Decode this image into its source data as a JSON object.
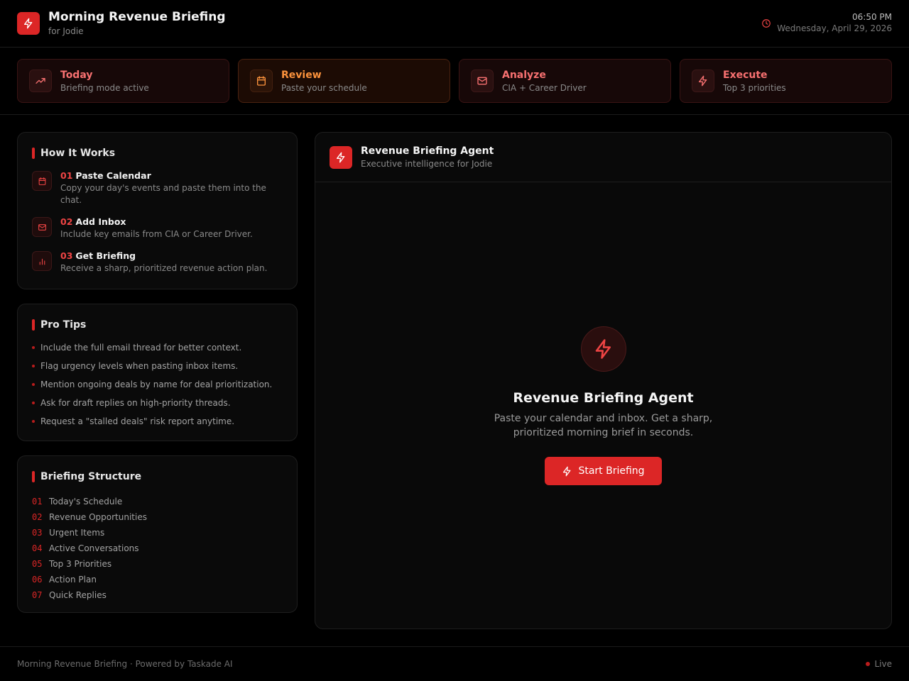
{
  "header": {
    "title": "Morning Revenue Briefing",
    "subtitle": "for Jodie",
    "time": "06:50 PM",
    "date": "Wednesday, April 29, 2026",
    "logo_icon": "lightning-icon",
    "clock_icon": "clock-icon"
  },
  "steps": [
    {
      "title": "Today",
      "subtitle": "Briefing mode active",
      "icon": "trending-up-icon"
    },
    {
      "title": "Review",
      "subtitle": "Paste your schedule",
      "icon": "calendar-icon"
    },
    {
      "title": "Analyze",
      "subtitle": "CIA + Career Driver",
      "icon": "mail-icon"
    },
    {
      "title": "Execute",
      "subtitle": "Top 3 priorities",
      "icon": "lightning-icon"
    }
  ],
  "how_it_works": {
    "title": "How It Works",
    "items": [
      {
        "num": "01",
        "title": "Paste Calendar",
        "desc": "Copy your day's events and paste them into the chat.",
        "icon": "calendar-icon"
      },
      {
        "num": "02",
        "title": "Add Inbox",
        "desc": "Include key emails from CIA or Career Driver.",
        "icon": "mail-icon"
      },
      {
        "num": "03",
        "title": "Get Briefing",
        "desc": "Receive a sharp, prioritized revenue action plan.",
        "icon": "bar-chart-icon"
      }
    ]
  },
  "pro_tips": {
    "title": "Pro Tips",
    "items": [
      "Include the full email thread for better context.",
      "Flag urgency levels when pasting inbox items.",
      "Mention ongoing deals by name for deal prioritization.",
      "Ask for draft replies on high-priority threads.",
      "Request a \"stalled deals\" risk report anytime."
    ]
  },
  "briefing_structure": {
    "title": "Briefing Structure",
    "items": [
      {
        "num": "01",
        "label": "Today's Schedule"
      },
      {
        "num": "02",
        "label": "Revenue Opportunities"
      },
      {
        "num": "03",
        "label": "Urgent Items"
      },
      {
        "num": "04",
        "label": "Active Conversations"
      },
      {
        "num": "05",
        "label": "Top 3 Priorities"
      },
      {
        "num": "06",
        "label": "Action Plan"
      },
      {
        "num": "07",
        "label": "Quick Replies"
      }
    ]
  },
  "agent": {
    "title": "Revenue Briefing Agent",
    "subtitle": "Executive intelligence for Jodie",
    "hero_title": "Revenue Briefing Agent",
    "hero_desc": "Paste your calendar and inbox. Get a sharp, prioritized morning brief in seconds.",
    "button_label": "Start Briefing"
  },
  "footer": {
    "text": "Morning Revenue Briefing · Powered by Taskade AI",
    "status": "Live"
  },
  "colors": {
    "accent": "#dc2626",
    "accent_text": "#f87171",
    "review_accent": "#fb923c",
    "background": "#000000"
  }
}
